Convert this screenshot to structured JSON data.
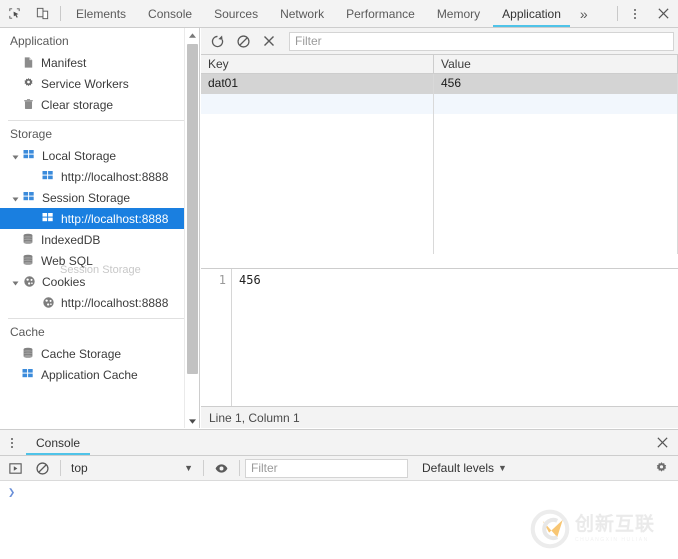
{
  "topbar": {
    "inspect_icon": "inspect-cursor-icon",
    "device_icon": "device-toolbar-icon",
    "tabs": [
      {
        "label": "Elements",
        "active": false
      },
      {
        "label": "Console",
        "active": false
      },
      {
        "label": "Sources",
        "active": false
      },
      {
        "label": "Network",
        "active": false
      },
      {
        "label": "Performance",
        "active": false
      },
      {
        "label": "Memory",
        "active": false
      },
      {
        "label": "Application",
        "active": true
      }
    ],
    "more_label": "»",
    "menu_icon": "kebab-menu-icon",
    "close_icon": "close-icon",
    "active_underline_color": "#4fc3e8"
  },
  "sidebar": {
    "application_section": {
      "title": "Application",
      "items": [
        {
          "label": "Manifest",
          "icon": "manifest-document-icon"
        },
        {
          "label": "Service Workers",
          "icon": "gear-icon"
        },
        {
          "label": "Clear storage",
          "icon": "trash-icon"
        }
      ]
    },
    "storage_section": {
      "title": "Storage",
      "items": [
        {
          "label": "Local Storage",
          "icon": "table-icon",
          "expanded": true,
          "indent": 0
        },
        {
          "label": "http://localhost:8888",
          "icon": "table-icon",
          "indent": 1
        },
        {
          "label": "Session Storage",
          "icon": "table-icon",
          "expanded": true,
          "indent": 0
        },
        {
          "label": "http://localhost:8888",
          "icon": "table-icon",
          "indent": 1,
          "selected": true
        },
        {
          "label": "IndexedDB",
          "icon": "database-icon",
          "indent": 0
        },
        {
          "label": "Web SQL",
          "icon": "database-icon",
          "indent": 0
        },
        {
          "label": "Cookies",
          "icon": "cookie-icon",
          "expanded": true,
          "indent": 0
        },
        {
          "label": "http://localhost:8888",
          "icon": "cookie-icon",
          "indent": 1
        }
      ],
      "ghost_label": "Session Storage"
    },
    "cache_section": {
      "title": "Cache",
      "items": [
        {
          "label": "Cache Storage",
          "icon": "database-icon"
        },
        {
          "label": "Application Cache",
          "icon": "table-icon"
        }
      ]
    },
    "selection_color": "#1a7fe0"
  },
  "panel": {
    "toolbar": {
      "refresh_icon": "refresh-icon",
      "clear_icon": "clear-prohibited-icon",
      "delete_icon": "delete-x-icon",
      "filter_placeholder": "Filter",
      "filter_value": ""
    },
    "table": {
      "columns": [
        "Key",
        "Value"
      ],
      "rows": [
        {
          "key": "dat01",
          "value": "456",
          "selected": true
        }
      ]
    },
    "preview": {
      "line_number": "1",
      "content": "456"
    },
    "statusbar": {
      "text": "Line 1, Column 1"
    }
  },
  "drawer": {
    "menu_icon": "kebab-menu-icon",
    "tabs": [
      {
        "label": "Console",
        "active": true
      }
    ],
    "close_icon": "close-icon",
    "toolbar": {
      "execution_icon": "execution-context-icon",
      "clear_icon": "clear-console-icon",
      "context_value": "top",
      "eye_icon": "live-expression-eye-icon",
      "filter_placeholder": "Filter",
      "filter_value": "",
      "levels_label": "Default levels",
      "settings_icon": "gear-icon"
    },
    "prompt_symbol": "❯"
  },
  "watermark": {
    "text": "创新互联",
    "subtext": "CHUANGXIN HULIAN",
    "logo_color": "#f5a623"
  }
}
